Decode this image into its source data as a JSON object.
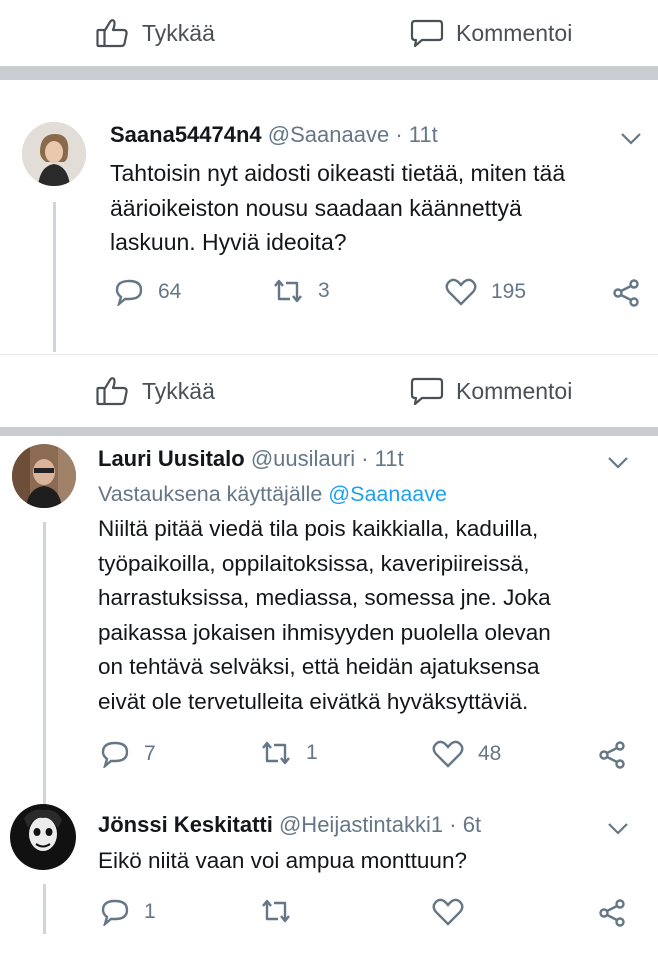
{
  "facebook_actions": {
    "like_label": "Tykkää",
    "comment_label": "Kommentoi"
  },
  "tweets": [
    {
      "name": "Saana54474n4",
      "handle": "@Saanaave",
      "time": "· 11t",
      "lines": [
        "Tahtoisin nyt aidosti oikeasti tietää, miten tää",
        "äärioikeiston nousu saadaan käännettyä",
        "laskuun. Hyviä ideoita?"
      ],
      "replies": "64",
      "retweets": "3",
      "likes": "195"
    },
    {
      "name": "Lauri Uusitalo",
      "handle": "@uusilauri",
      "time": "· 11t",
      "reply_prefix": "Vastauksena käyttäjälle",
      "reply_to": "@Saanaave",
      "lines": [
        "Niiltä pitää viedä tila pois kaikkialla, kaduilla,",
        "työpaikoilla, oppilaitoksissa, kaveripiireissä,",
        "harrastuksissa, mediassa, somessa jne. Joka",
        "paikassa jokaisen ihmisyyden puolella olevan",
        "on tehtävä selväksi, että heidän ajatuksensa",
        "eivät ole tervetulleita eivätkä hyväksyttäviä."
      ],
      "replies": "7",
      "retweets": "1",
      "likes": "48"
    },
    {
      "name": "Jönssi Keskitatti",
      "handle": "@Heijastintakki1",
      "time": "· 6t",
      "lines": [
        "Eikö niitä vaan voi ampua monttuun?"
      ],
      "replies": "1",
      "retweets": "",
      "likes": ""
    }
  ],
  "colors": {
    "text": "#14171a",
    "secondary": "#657786",
    "link": "#1da1f2",
    "separator": "#c9ccd1"
  },
  "icons": [
    "thumbs-up-icon",
    "comment-bubble-icon",
    "reply-icon",
    "retweet-icon",
    "heart-icon",
    "share-icon",
    "chevron-down-icon"
  ]
}
